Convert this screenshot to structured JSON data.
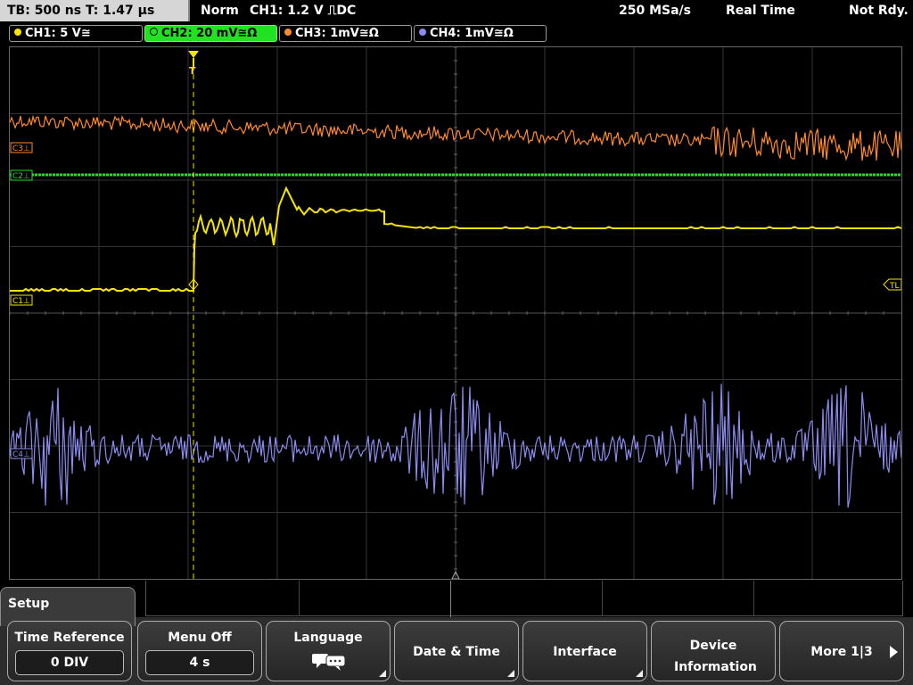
{
  "status": {
    "timebase": "TB: 500 ns   T: 1.47 µs",
    "mode": "Norm",
    "trigger": "CH1: 1.2 V ⎍DC",
    "sample_rate": "250 MSa/s",
    "acquisition": "Real Time",
    "state": "Not Rdy."
  },
  "channels": [
    {
      "label": "CH1: 5 V≅",
      "color": "#f5e400"
    },
    {
      "label": "CH2: 20 mV≅Ω",
      "color": "#22e022"
    },
    {
      "label": "CH3: 1mV≅Ω",
      "color": "#ff8a2e"
    },
    {
      "label": "CH4: 1mV≅Ω",
      "color": "#8c8cf0"
    }
  ],
  "markers": {
    "c3": "C3⊥",
    "c2": "C2⊥",
    "c1": "C1⊥",
    "c4": "C4⊥",
    "trigger_level": "TL",
    "trigger_position": "T"
  },
  "menu": {
    "title": "Setup",
    "softkeys": [
      {
        "label": "Time Reference",
        "value": "0 DIV"
      },
      {
        "label": "Menu Off",
        "value": "4 s"
      },
      {
        "label": "Language",
        "icon": "speech-bubbles-icon"
      },
      {
        "label": "Date & Time"
      },
      {
        "label": "Interface"
      },
      {
        "label": "Device Information"
      },
      {
        "label": "More 1|3"
      }
    ]
  }
}
